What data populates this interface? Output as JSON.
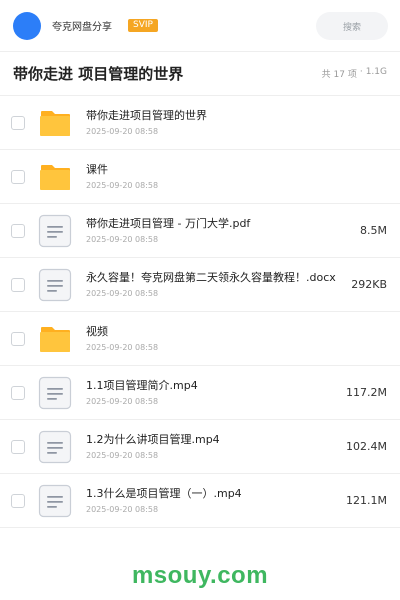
{
  "header": {
    "share_name": "夸克网盘分享",
    "vip_badge": "SVIP",
    "search_label": "搜索",
    "avatar_color": "#2c7ef8",
    "badge_color": "#f5a623"
  },
  "title_row": {
    "folder_title": "带你走进 项目管理的世界",
    "item_count": "共 17 项",
    "separator": "·",
    "total_size": "1.1G"
  },
  "files": [
    {
      "name": "带你走进项目管理的世界",
      "date": "2025-09-20 08:58",
      "size": "",
      "type": "folder"
    },
    {
      "name": "课件",
      "date": "2025-09-20 08:58",
      "size": "",
      "type": "folder"
    },
    {
      "name": "带你走进项目管理 - 万门大学.pdf",
      "date": "2025-09-20 08:58",
      "size": "8.5M",
      "type": "file"
    },
    {
      "name": "永久容量！夸克网盘第二天领永久容量教程！.docx",
      "date": "2025-09-20 08:58",
      "size": "292KB",
      "type": "file"
    },
    {
      "name": "视频",
      "date": "2025-09-20 08:58",
      "size": "",
      "type": "folder"
    },
    {
      "name": "1.1项目管理简介.mp4",
      "date": "2025-09-20 08:58",
      "size": "117.2M",
      "type": "file"
    },
    {
      "name": "1.2为什么讲项目管理.mp4",
      "date": "2025-09-20 08:58",
      "size": "102.4M",
      "type": "file"
    },
    {
      "name": "1.3什么是项目管理（一）.mp4",
      "date": "2025-09-20 08:58",
      "size": "121.1M",
      "type": "file"
    }
  ],
  "icons": {
    "folder": "folder-icon",
    "file": "document-icon"
  },
  "colors": {
    "folder_yellow": "#ffc53d",
    "watermark_green": "#3fb760"
  },
  "watermark": "msouy.com"
}
